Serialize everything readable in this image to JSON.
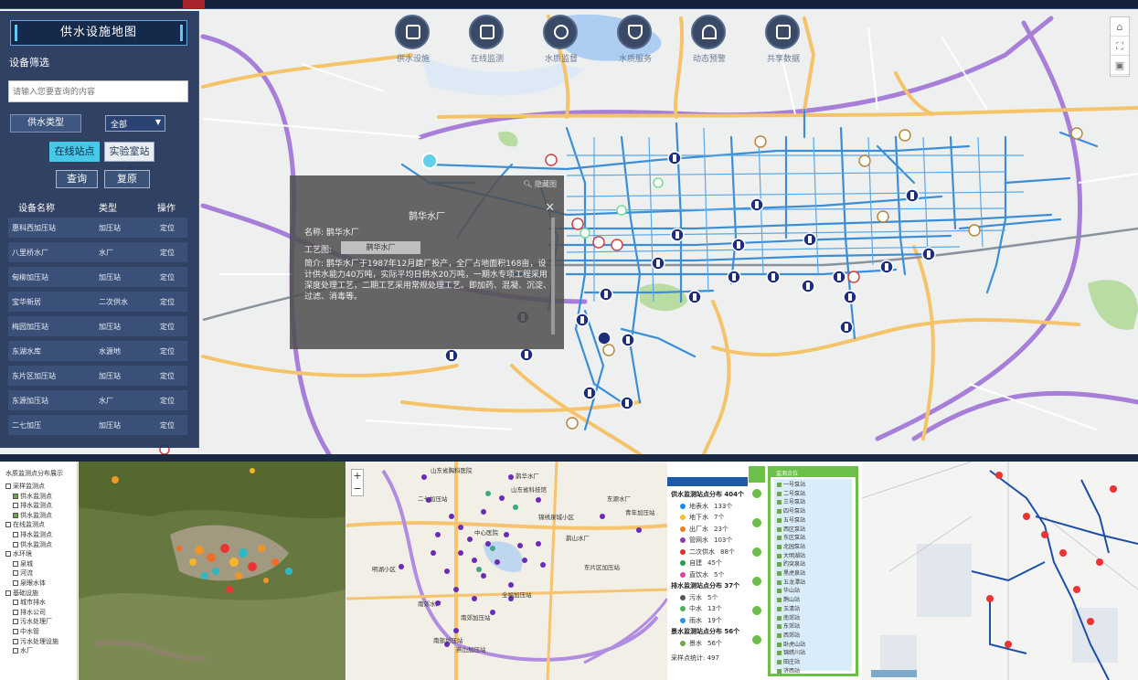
{
  "topbar": {
    "text": "..."
  },
  "panel": {
    "title": "供水设施地图",
    "filter_label": "设备筛选",
    "search_placeholder": "请输入您要查询的内容",
    "type_label": "供水类型",
    "type_value": "全部",
    "btn_online": "在线站点",
    "btn_lab": "实验室站点",
    "btn_query": "查询",
    "btn_reset": "复原",
    "columns": [
      "设备名称",
      "类型",
      "操作"
    ],
    "rows": [
      {
        "name": "惠科西加压站",
        "type": "加压站",
        "op": "定位"
      },
      {
        "name": "八里桥水厂",
        "type": "水厂",
        "op": "定位"
      },
      {
        "name": "甸柳加压站",
        "type": "加压站",
        "op": "定位"
      },
      {
        "name": "宝华新居",
        "type": "二次供水",
        "op": "定位"
      },
      {
        "name": "梅园加压站",
        "type": "加压站",
        "op": "定位"
      },
      {
        "name": "东湖水库",
        "type": "水源地",
        "op": "定位"
      },
      {
        "name": "东片区加压站",
        "type": "加压站",
        "op": "定位"
      },
      {
        "name": "东源加压站",
        "type": "水厂",
        "op": "定位"
      },
      {
        "name": "二七加压",
        "type": "加压站",
        "op": "定位"
      }
    ]
  },
  "top_icons": [
    {
      "label": "供水设施",
      "icon": "facility-icon"
    },
    {
      "label": "在线监测",
      "icon": "monitor-icon"
    },
    {
      "label": "水质监督",
      "icon": "gauge-icon"
    },
    {
      "label": "水质服务",
      "icon": "shield-icon"
    },
    {
      "label": "动态预警",
      "icon": "alarm-icon"
    },
    {
      "label": "共享数据",
      "icon": "database-icon"
    }
  ],
  "popup": {
    "top_link": "隐藏图",
    "title": "鹊华水厂",
    "name": "名称: 鹊华水厂",
    "process_label": "工艺图:",
    "process_btn": "鹊华水厂",
    "desc": "简介: 鹊华水厂于1987年12月建厂投产，全厂占地面积168亩，设计供水能力40万吨，实际平均日供水20万吨，一期水专项工程采用深度处理工艺，二期工艺采用常规处理工艺。即加药、混凝、沉淀、过滤、消毒等。"
  },
  "bottom": {
    "tree_title": "水质监测点分布展示",
    "tree_items": [
      {
        "label": "采样监测点",
        "on": false
      },
      {
        "label": "供水监测点",
        "on": true
      },
      {
        "label": "排水监测点",
        "on": false
      },
      {
        "label": "供水监测点",
        "on": true
      },
      {
        "label": "在线监测点",
        "on": false
      },
      {
        "label": "排水监测点",
        "on": false
      },
      {
        "label": "供水监测点",
        "on": false
      },
      {
        "label": "水环境",
        "on": false
      },
      {
        "label": "泉城",
        "on": false
      },
      {
        "label": "河流",
        "on": false
      },
      {
        "label": "泉眼水体",
        "on": false
      },
      {
        "label": "基础设施",
        "on": false
      },
      {
        "label": "城市排水",
        "on": false
      },
      {
        "label": "排水公司",
        "on": false
      },
      {
        "label": "污水处理厂",
        "on": false
      },
      {
        "label": "中水管",
        "on": false
      },
      {
        "label": "污水处理设施",
        "on": false
      },
      {
        "label": "水厂",
        "on": false
      }
    ],
    "stats_title": "供水监测站点分布 404个",
    "stats": [
      {
        "label": "地表水",
        "value": "133个",
        "color": "#1e88e5"
      },
      {
        "label": "地下水",
        "value": "7个",
        "color": "#f6c026"
      },
      {
        "label": "出厂水",
        "value": "23个",
        "color": "#e57e25"
      },
      {
        "label": "管网水",
        "value": "103个",
        "color": "#8e3ab5"
      },
      {
        "label": "二次供水",
        "value": "88个",
        "color": "#d6342c"
      },
      {
        "label": "自建",
        "value": "45个",
        "color": "#2f9c4a"
      },
      {
        "label": "直饮水",
        "value": "5个",
        "color": "#e040a0"
      }
    ],
    "stats2_title": "排水监测站点分布 37个",
    "stats2": [
      {
        "label": "污水",
        "value": "5个",
        "color": "#555"
      },
      {
        "label": "中水",
        "value": "13个",
        "color": "#4caf50"
      },
      {
        "label": "雨水",
        "value": "19个",
        "color": "#2196f3"
      }
    ],
    "stats3_title": "景水监测站点分布 56个",
    "stats3": [
      {
        "label": "景水",
        "value": "56个",
        "color": "#6aa84f"
      }
    ],
    "total": "采样点统计: 497",
    "list_head": "监测点位",
    "list_items": [
      "一号泵站",
      "二号泵站",
      "三号泵站",
      "四号泵站",
      "五号泵站",
      "西区泵站",
      "东区泵站",
      "北园泵站",
      "大明湖站",
      "趵突泉站",
      "黑虎泉站",
      "五龙潭站",
      "华山站",
      "鹊山站",
      "玉清站",
      "南郊站",
      "东郊站",
      "西郊站",
      "卧虎山站",
      "锦绣川站",
      "田庄站",
      "济西站"
    ]
  },
  "map_labels": [
    "山东省胸科医院",
    "鹊华水厂",
    "二七加压站",
    "东源水厂",
    "锦绣泉城小区",
    "山东省科技馆",
    "鹊山水厂",
    "全福加压站",
    "明湖小区",
    "东片区加压站",
    "南郊加压站",
    "南郊水厂",
    "燕山加压站",
    "青年加压站",
    "中心医院",
    "南部加压站"
  ]
}
